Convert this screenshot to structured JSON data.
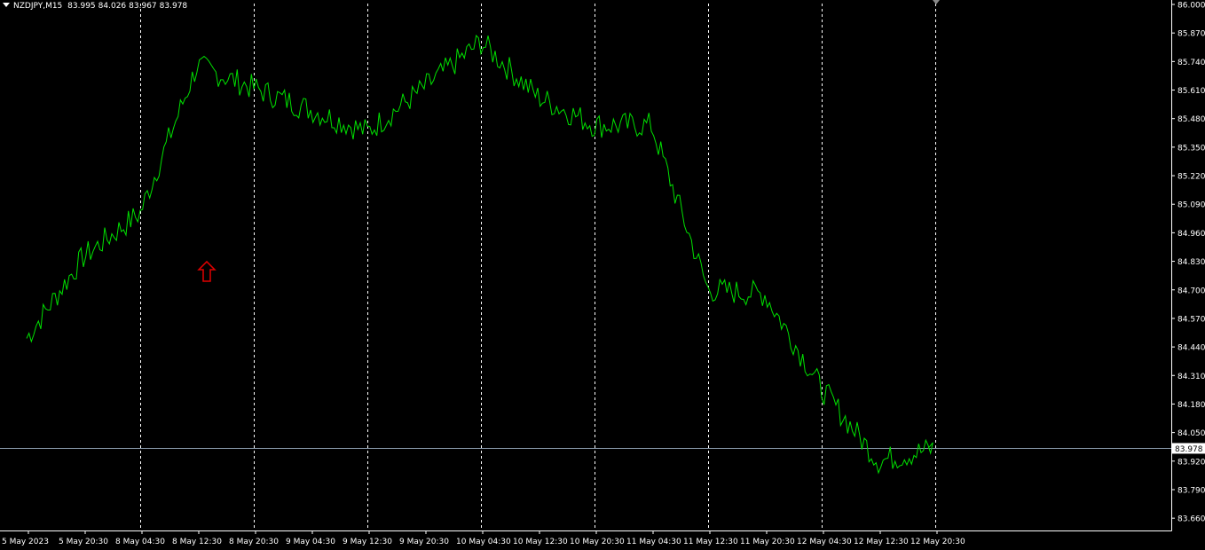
{
  "header": {
    "symbol": "NZDJPY,M15",
    "open": "83.995",
    "high": "84.026",
    "low": "83.967",
    "close": "83.978"
  },
  "colors": {
    "background": "#000000",
    "line": "#00e000",
    "grid": "#ffffff",
    "axis": "#ffffff",
    "price_line": "#8899aa",
    "arrow": "#e00000"
  },
  "chart_data": {
    "type": "line",
    "title": "",
    "xlabel": "",
    "ylabel": "",
    "ylim": [
      83.6,
      86.0
    ],
    "y_ticks": [
      "86.000",
      "85.870",
      "85.740",
      "85.610",
      "85.480",
      "85.350",
      "85.220",
      "85.090",
      "84.960",
      "84.830",
      "84.700",
      "84.570",
      "84.440",
      "84.310",
      "84.180",
      "84.050",
      "83.920",
      "83.790",
      "83.660"
    ],
    "current_price": "83.978",
    "x_ticks": [
      "5 May 2023",
      "5 May 20:30",
      "8 May 04:30",
      "8 May 12:30",
      "8 May 20:30",
      "9 May 04:30",
      "9 May 12:30",
      "9 May 20:30",
      "10 May 04:30",
      "10 May 12:30",
      "10 May 20:30",
      "11 May 04:30",
      "11 May 12:30",
      "11 May 20:30",
      "12 May 04:30",
      "12 May 12:30",
      "12 May 20:30"
    ],
    "period_separators": [
      "5 May 20:30",
      "8 May 12:30",
      "9 May 04:30",
      "9 May 20:30",
      "10 May 12:30",
      "11 May 04:30",
      "11 May 20:30",
      "12 May 12:30"
    ],
    "grid": false,
    "series": [
      {
        "x": [
          "5 May 2023",
          "5 May 20:30",
          "8 May 04:30",
          "8 May 12:30",
          "8 May 20:30",
          "9 May 04:30",
          "9 May 12:30",
          "9 May 20:30",
          "10 May 04:30",
          "10 May 12:30",
          "10 May 20:30",
          "11 May 04:30",
          "11 May 12:30",
          "11 May 20:30",
          "12 May 04:30",
          "12 May 12:30",
          "12 May 20:30"
        ],
        "values": [
          84.48,
          84.85,
          85.05,
          85.72,
          85.62,
          85.52,
          85.42,
          85.62,
          85.83,
          85.58,
          85.45,
          85.45,
          84.7,
          84.68,
          84.25,
          83.92,
          83.978
        ]
      }
    ],
    "annotations": [
      {
        "type": "up-arrow",
        "x": "8 May 12:30",
        "y": 84.78
      }
    ]
  }
}
